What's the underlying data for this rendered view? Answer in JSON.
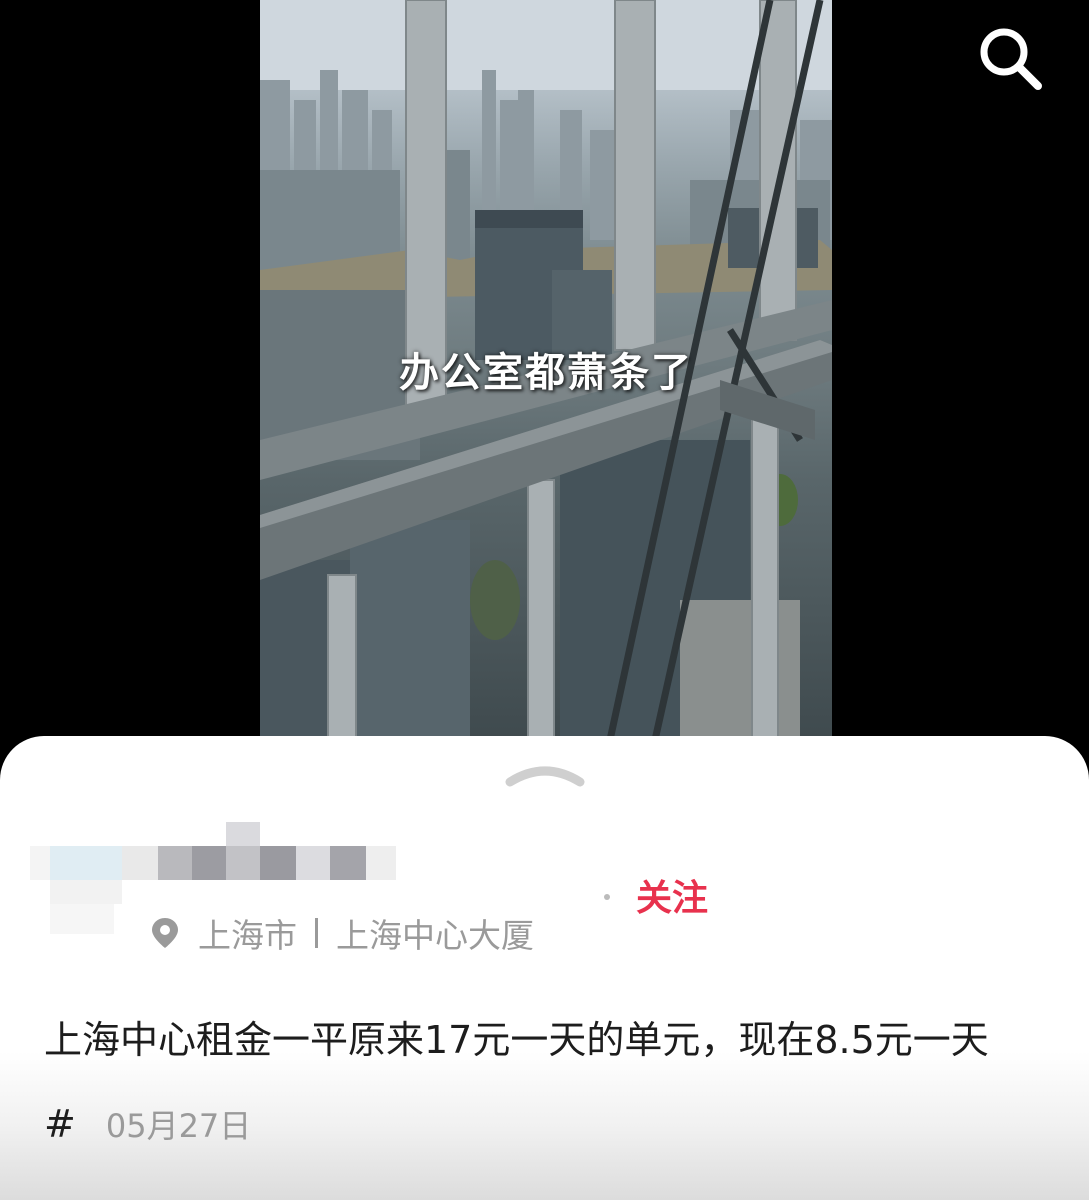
{
  "video": {
    "caption": "办公室都萧条了"
  },
  "toolbar": {
    "search_icon": "search-icon"
  },
  "sheet": {
    "expand_icon": "chevron-up-icon",
    "follow_label": "关注",
    "location": {
      "icon": "location-pin-icon",
      "city": "上海市",
      "place": "上海中心大厦"
    },
    "description": "上海中心租金一平原来17元一天的单元，现在8.5元一天#",
    "date": "05月27日"
  },
  "colors": {
    "accent": "#e8314d",
    "muted_text": "#9a9a9a",
    "body_text": "#1d1d1d"
  }
}
